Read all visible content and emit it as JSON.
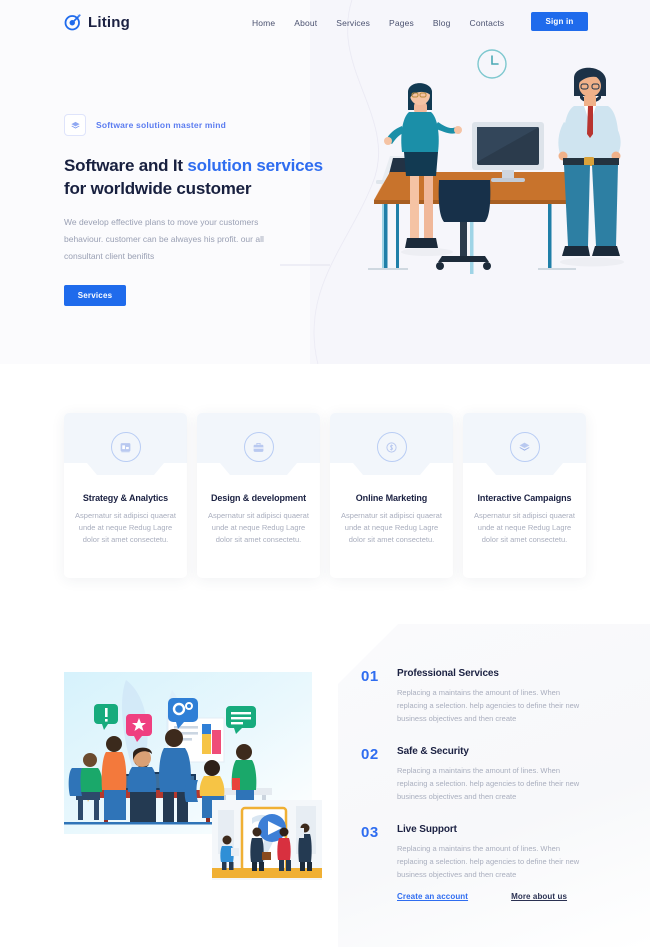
{
  "brand": {
    "name": "Liting",
    "logo_icon": "target-dart-icon",
    "color": "#1f6bec"
  },
  "nav": {
    "links": [
      {
        "label": "Home"
      },
      {
        "label": "About"
      },
      {
        "label": "Services"
      },
      {
        "label": "Pages"
      },
      {
        "label": "Blog"
      },
      {
        "label": "Contacts"
      }
    ],
    "signin_label": "Sign in"
  },
  "hero": {
    "eyebrow": "Software solution master mind",
    "eyebrow_icon": "layers-stack-icon",
    "title_part1": "Software and It ",
    "title_highlight": "solution services",
    "title_part2": " for worldwide customer",
    "description": "We develop effective plans to move your customers behaviour. customer can be alwayes his profit. our all consultant client benifits",
    "cta_label": "Services",
    "illustration": "office-team-desk-illustration",
    "clock_icon": "wall-clock-icon"
  },
  "cards": [
    {
      "icon": "chart-board-icon",
      "title": "Strategy & Analytics",
      "text": "Aspernatur sit adipisci quaerat unde at neque Redug Lagre dolor sit amet consectetu."
    },
    {
      "icon": "briefcase-icon",
      "title": "Design & development",
      "text": "Aspernatur sit adipisci quaerat unde at neque Redug Lagre dolor sit amet consectetu."
    },
    {
      "icon": "coin-dollar-icon",
      "title": "Online Marketing",
      "text": "Aspernatur sit adipisci quaerat unde at neque Redug Lagre dolor sit amet consectetu."
    },
    {
      "icon": "layers-stack-icon",
      "title": "Interactive Campaigns",
      "text": "Aspernatur sit adipisci quaerat unde at neque Redug Lagre dolor sit amet consectetu."
    }
  ],
  "features": {
    "illustration": "team-collaboration-illustration",
    "video_card": "video-play-illustration",
    "items": [
      {
        "number": "01",
        "title": "Professional Services",
        "text": "Replacing a maintains the amount of lines. When replacing a selection. help agencies to define their new business objectives and then create"
      },
      {
        "number": "02",
        "title": "Safe & Security",
        "text": "Replacing a maintains the amount of lines. When replacing a selection. help agencies to define their new business objectives and then create"
      },
      {
        "number": "03",
        "title": "Live Support",
        "text": "Replacing a maintains the amount of lines. When replacing a selection. help agencies to define their new business objectives and then create"
      }
    ],
    "links": [
      {
        "label": "Create an account",
        "style": "blue"
      },
      {
        "label": "More about us",
        "style": "dark"
      }
    ]
  }
}
